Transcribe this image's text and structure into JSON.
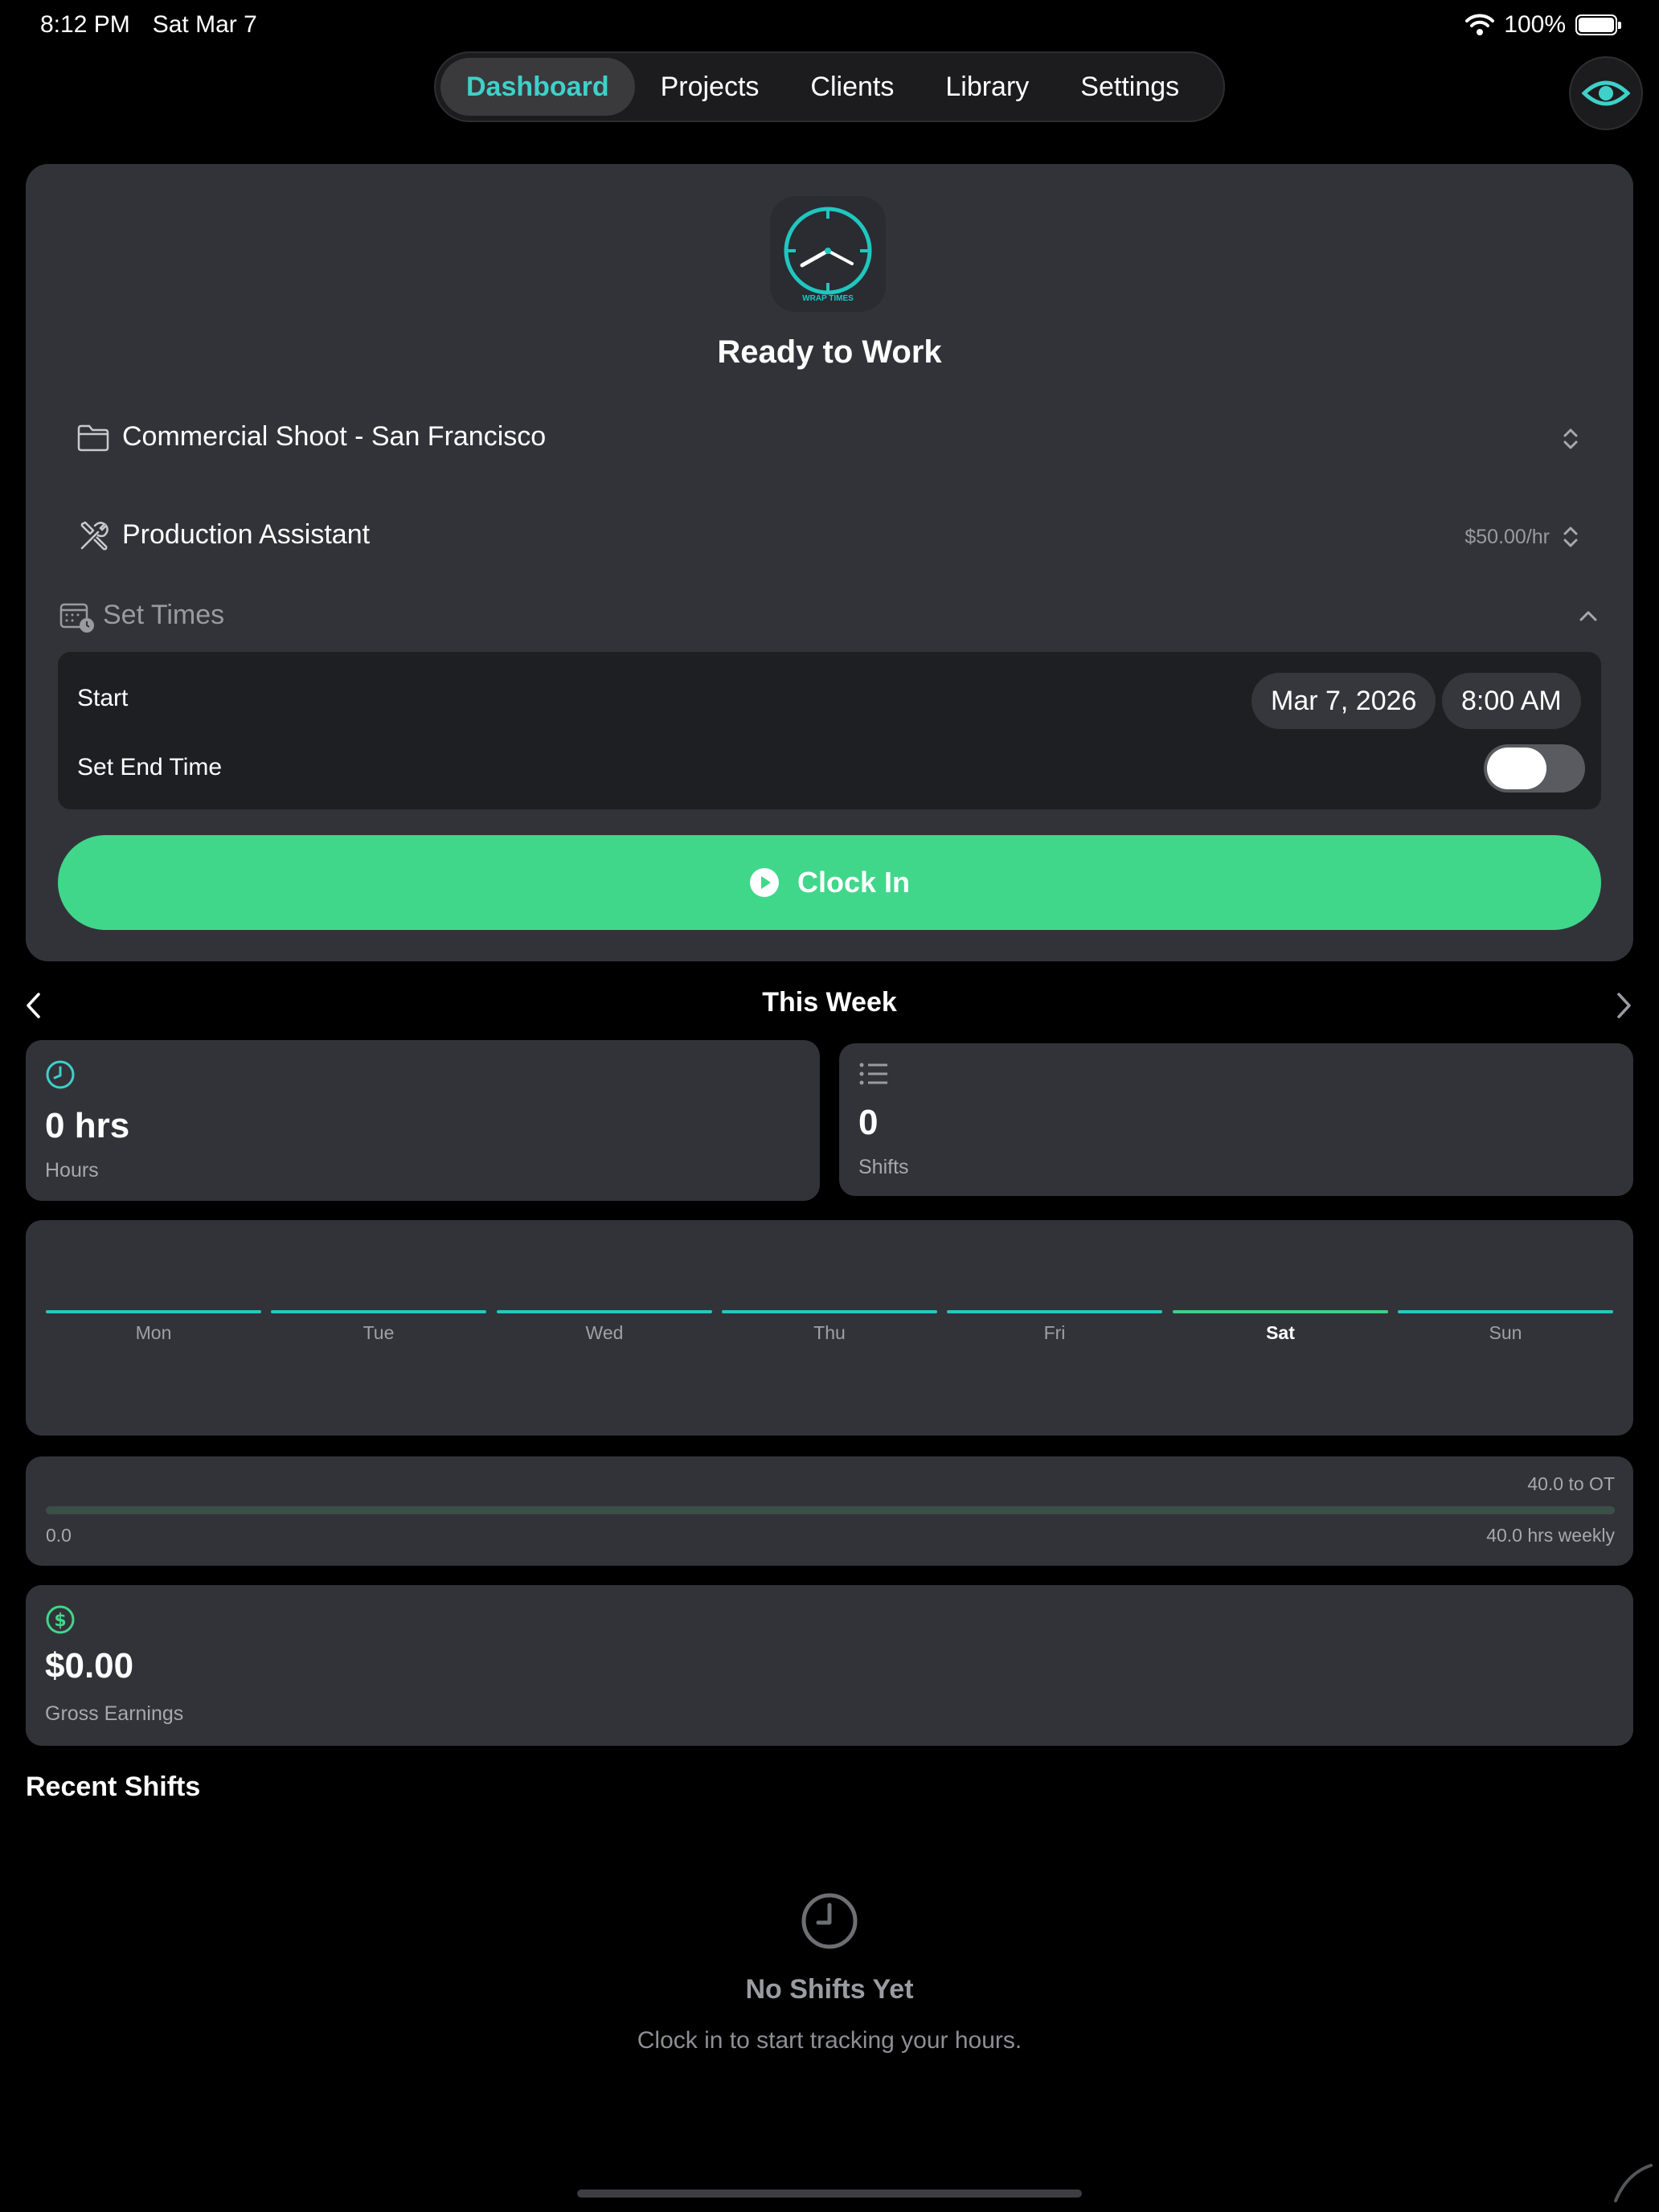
{
  "status_bar": {
    "time": "8:12 PM",
    "date": "Sat Mar 7",
    "battery": "100%"
  },
  "nav": {
    "tabs": [
      {
        "label": "Dashboard",
        "active": true
      },
      {
        "label": "Projects"
      },
      {
        "label": "Clients"
      },
      {
        "label": "Library"
      },
      {
        "label": "Settings"
      }
    ]
  },
  "app_icon_text": "WRAP TIMES",
  "clock_card": {
    "status": "Ready to Work",
    "project": "Commercial Shoot - San Francisco",
    "role": "Production Assistant",
    "rate": "$50.00/hr",
    "set_times_label": "Set Times",
    "start_label": "Start",
    "start_date": "Mar 7, 2026",
    "start_time": "8:00 AM",
    "end_time_label": "Set End Time",
    "end_time_enabled": false,
    "clock_in_label": "Clock In"
  },
  "week": {
    "title": "This Week",
    "hours_value": "0 hrs",
    "hours_label": "Hours",
    "shifts_value": "0",
    "shifts_label": "Shifts",
    "days": [
      "Mon",
      "Tue",
      "Wed",
      "Thu",
      "Fri",
      "Sat",
      "Sun"
    ],
    "today": "Sat",
    "ot_remaining": "40.0 to OT",
    "progress_value": "0.0",
    "weekly_limit": "40.0 hrs weekly",
    "progress_fraction": 0,
    "earnings_value": "$0.00",
    "earnings_label": "Gross Earnings"
  },
  "recent": {
    "title": "Recent Shifts",
    "empty_title": "No Shifts Yet",
    "empty_sub": "Clock in to start tracking your hours."
  },
  "colors": {
    "accent": "#3fd0c9",
    "green": "#40d78b",
    "card": "#323339"
  }
}
